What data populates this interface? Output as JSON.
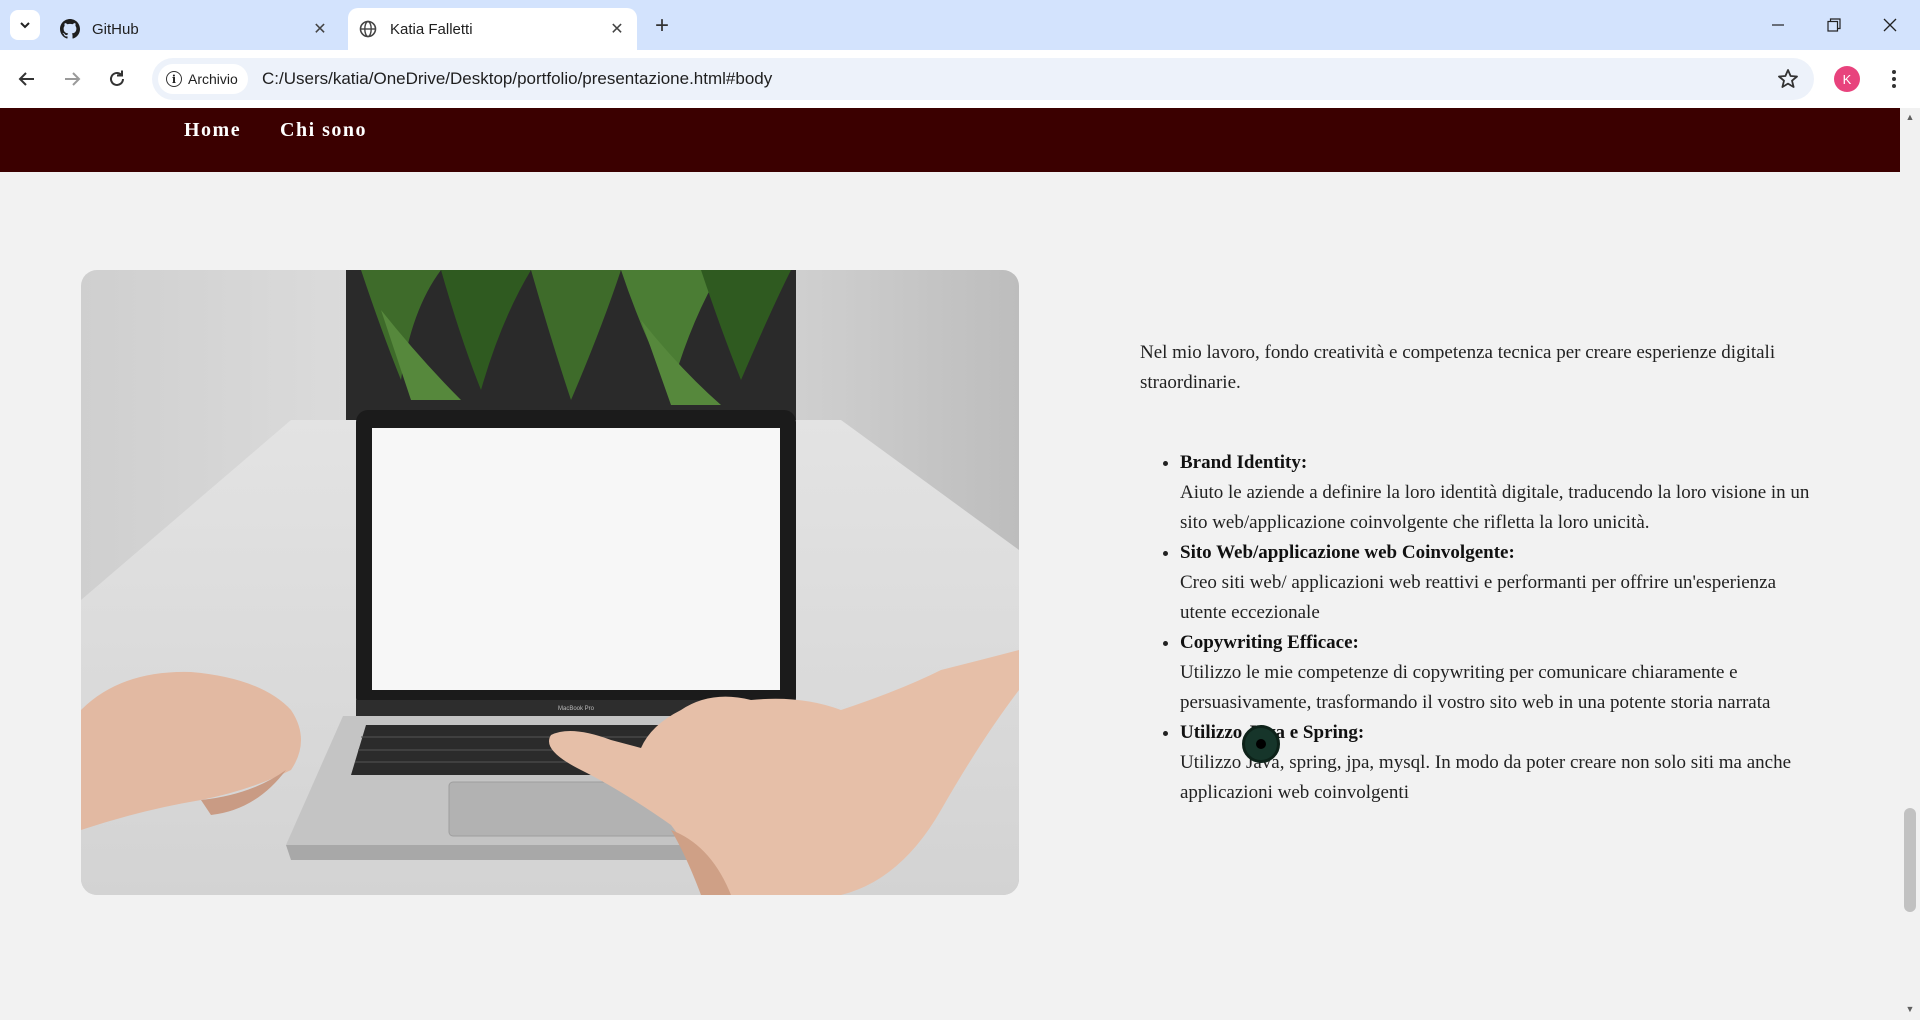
{
  "browser": {
    "tabs": [
      {
        "title": "GitHub",
        "active": false,
        "icon": "github-icon"
      },
      {
        "title": "Katia Falletti",
        "active": true,
        "icon": "globe-icon"
      }
    ],
    "site_chip": "Archivio",
    "url": "C:/Users/katia/OneDrive/Desktop/portfolio/presentazione.html#body",
    "profile_initial": "K",
    "profile_color": "#e8437d",
    "chrome_color": "#d3e3fd"
  },
  "site": {
    "nav_color": "#3b0000",
    "nav": [
      {
        "label": "Home"
      },
      {
        "label": "Chi sono"
      }
    ],
    "intro": "Nel mio lavoro, fondo creatività e competenza tecnica per creare esperienze digitali straordinarie.",
    "services": [
      {
        "title": "Brand Identity:",
        "text": "Aiuto le aziende a definire la loro identità digitale, traducendo la loro visione in un sito web/applicazione coinvolgente che rifletta la loro unicità."
      },
      {
        "title": "Sito Web/applicazione web Coinvolgente:",
        "text": "Creo siti web/ applicazioni web reattivi e performanti per offrire un'esperienza utente eccezionale"
      },
      {
        "title": "Copywriting Efficace:",
        "text": "Utilizzo le mie competenze di copywriting per comunicare chiaramente e persuasivamente, trasformando il vostro sito web in una potente storia narrata"
      },
      {
        "title": "Utilizzo Java e Spring:",
        "text": "Utilizzo Java, spring, jpa, mysql. In modo da poter creare non solo siti ma anche applicazioni web coinvolgenti"
      }
    ],
    "laptop_brand": "MacBook Pro"
  }
}
